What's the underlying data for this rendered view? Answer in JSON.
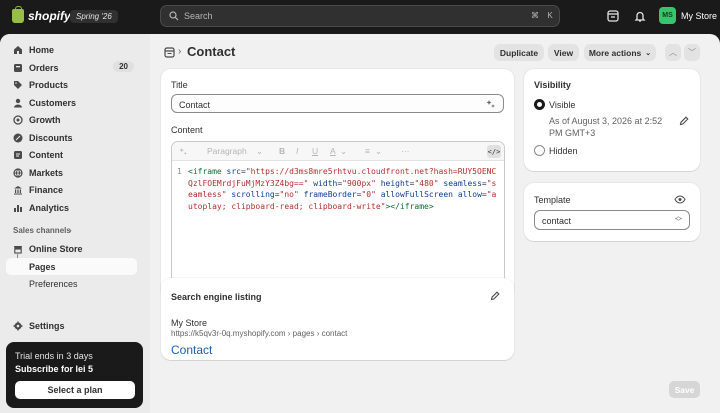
{
  "topbar": {
    "brand": "shopify",
    "edition": "Spring '26",
    "search_placeholder": "Search",
    "shortcut_mod": "⌘",
    "shortcut_key": "K",
    "store_initials": "MS",
    "store_name": "My Store"
  },
  "sidebar": {
    "items": [
      {
        "label": "Home",
        "icon": "home-icon"
      },
      {
        "label": "Orders",
        "icon": "orders-icon",
        "badge": "20"
      },
      {
        "label": "Products",
        "icon": "tag-icon"
      },
      {
        "label": "Customers",
        "icon": "person-icon"
      },
      {
        "label": "Growth",
        "icon": "target-icon"
      },
      {
        "label": "Discounts",
        "icon": "discount-icon"
      },
      {
        "label": "Content",
        "icon": "content-icon"
      },
      {
        "label": "Markets",
        "icon": "globe-icon"
      },
      {
        "label": "Finance",
        "icon": "bank-icon"
      },
      {
        "label": "Analytics",
        "icon": "chart-icon"
      }
    ],
    "sales_channels_label": "Sales channels",
    "online_store_label": "Online Store",
    "sub_items": [
      {
        "label": "Pages",
        "active": true
      },
      {
        "label": "Preferences",
        "active": false
      }
    ],
    "settings_label": "Settings",
    "trial": {
      "line1": "Trial ends in 3 days",
      "line2": "Subscribe for lei 5",
      "button": "Select a plan"
    }
  },
  "header": {
    "breadcrumb_sep": "›",
    "title": "Contact",
    "duplicate": "Duplicate",
    "view": "View",
    "more_actions": "More actions"
  },
  "main": {
    "title_label": "Title",
    "title_value": "Contact",
    "content_label": "Content",
    "toolbar": {
      "paragraph": "Paragraph",
      "bold": "B",
      "italic": "I",
      "underline": "U",
      "color": "A",
      "align": "≡",
      "more": "···",
      "code": "</>"
    },
    "code": {
      "line_number": "1",
      "tokens": [
        {
          "t": "tag",
          "v": "<iframe "
        },
        {
          "t": "attr",
          "v": "src"
        },
        {
          "t": "pun",
          "v": "="
        },
        {
          "t": "str",
          "v": "\"https://d3ms8mre5rhtvu.cloudfront.net?hash=RUY5OENCQzlFOEMrdjFuMjMzY3Z4bg==\""
        },
        {
          "t": "pun",
          "v": " "
        },
        {
          "t": "attr",
          "v": "width"
        },
        {
          "t": "pun",
          "v": "="
        },
        {
          "t": "str",
          "v": "\"900px\""
        },
        {
          "t": "pun",
          "v": " "
        },
        {
          "t": "attr",
          "v": "height"
        },
        {
          "t": "pun",
          "v": "="
        },
        {
          "t": "str",
          "v": "\"480\""
        },
        {
          "t": "pun",
          "v": " "
        },
        {
          "t": "attr",
          "v": "seamless"
        },
        {
          "t": "pun",
          "v": "="
        },
        {
          "t": "str",
          "v": "\"seamless\""
        },
        {
          "t": "pun",
          "v": " "
        },
        {
          "t": "attr",
          "v": "scrolling"
        },
        {
          "t": "pun",
          "v": "="
        },
        {
          "t": "str",
          "v": "\"no\""
        },
        {
          "t": "pun",
          "v": " "
        },
        {
          "t": "attr",
          "v": "frameBorder"
        },
        {
          "t": "pun",
          "v": "="
        },
        {
          "t": "str",
          "v": "\"0\""
        },
        {
          "t": "pun",
          "v": " "
        },
        {
          "t": "attr",
          "v": "allowFullScreen"
        },
        {
          "t": "pun",
          "v": " "
        },
        {
          "t": "attr",
          "v": "allow"
        },
        {
          "t": "pun",
          "v": "="
        },
        {
          "t": "str",
          "v": "\"autoplay; clipboard-read; clipboard-write\""
        },
        {
          "t": "tag",
          "v": "></iframe>"
        }
      ]
    },
    "seo": {
      "title": "Search engine listing",
      "store": "My Store",
      "url": "https://k5qv3r-0q.myshopify.com › pages › contact",
      "page_title": "Contact"
    }
  },
  "visibility": {
    "title": "Visibility",
    "visible_label": "Visible",
    "visible_note": "As of August 3, 2026 at 2:52 PM GMT+3",
    "hidden_label": "Hidden",
    "selected": "visible"
  },
  "template": {
    "title": "Template",
    "value": "contact"
  },
  "save": "Save"
}
